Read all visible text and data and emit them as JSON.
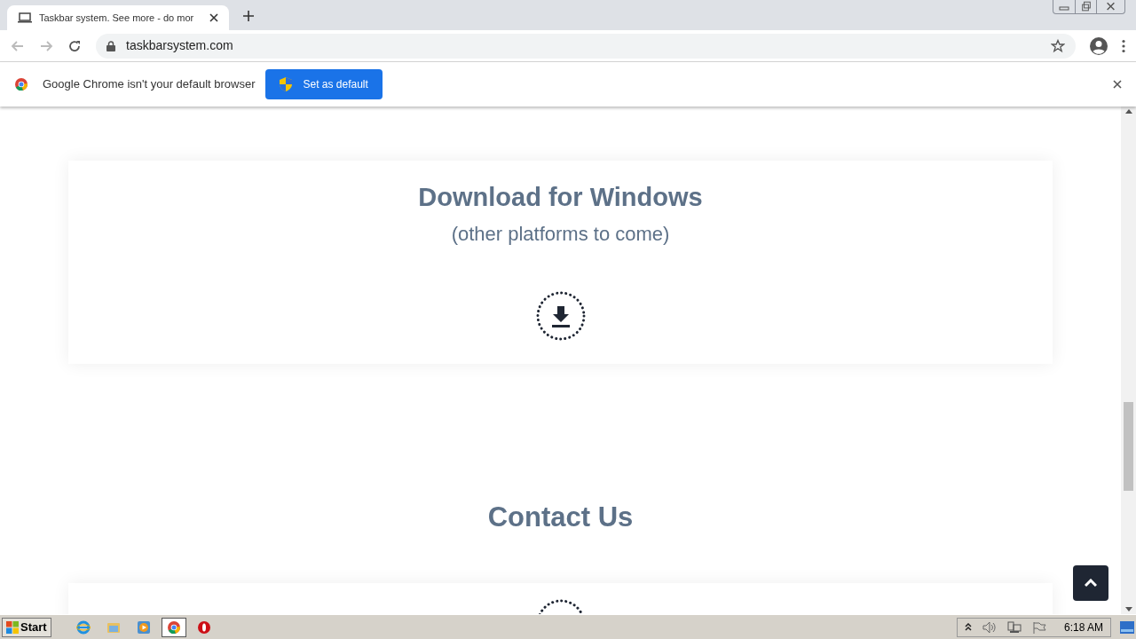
{
  "tabs": [
    {
      "title": "Taskbar system. See more - do mor",
      "selected": true
    }
  ],
  "address": {
    "url": "taskbarsystem.com"
  },
  "infobar": {
    "message": "Google Chrome isn't your default browser",
    "button": "Set as default"
  },
  "page": {
    "download": {
      "title": "Download for Windows",
      "subtitle": "(other platforms to come)"
    },
    "contact": {
      "title": "Contact Us"
    }
  },
  "taskbar": {
    "start": "Start",
    "apps": [
      {
        "kind": "ie",
        "selected": false
      },
      {
        "kind": "folder",
        "selected": false
      },
      {
        "kind": "media",
        "selected": false
      },
      {
        "kind": "chrome",
        "selected": true
      },
      {
        "kind": "opera",
        "selected": false
      }
    ],
    "clock": "6:18 AM"
  }
}
